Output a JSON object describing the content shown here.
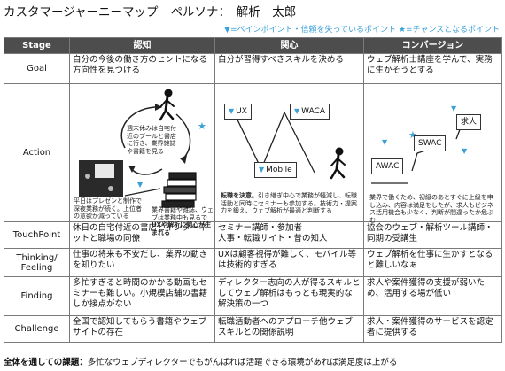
{
  "title": "カスタマージャーニーマップ",
  "persona": "ペルソナ：　解析　太郎",
  "legend": "▼=ペインポイント・信頼を失っているポイント ★=チャンスとなるポイント",
  "headers": [
    "Stage",
    "認知",
    "関心",
    "コンバージョン"
  ],
  "rows": {
    "goal": {
      "label": "Goal",
      "cells": [
        "自分の今後の働き方のヒントになる方向性を見つける",
        "自分が習得すべきスキルを決める",
        "ウェブ解析士講座を学んで、実務に生かそうとする"
      ]
    },
    "action": {
      "label": "Action"
    },
    "touchpoint": {
      "label": "TouchPoint",
      "cells": [
        "休日の自宅付近の書店とインターネットと職場の同僚",
        "セミナー講師・参加者\n人事・転職サイト・昔の知人",
        "協会のウェブ・解析ツール講師・同期の受講生"
      ]
    },
    "thinking": {
      "label": "Thinking/\nFeeling",
      "cells": [
        "仕事の将来も不安だし、業界の動きを知りたい",
        "UXは顧客視得が難しく、モバイル等は技術的すぎる",
        "ウェブ解析を仕事に生かすとなると難しいなぁ"
      ]
    },
    "finding": {
      "label": "Finding",
      "cells": [
        "多忙すぎると時間のかかる動画もセミナーも難しい。小規模店舗の書籍しか接点がない",
        "ディレクター志向の人が得るスキルとしてウェブ解析はもっとも現実的な解決策の一つ",
        "求人や案件獲得の支援が弱いため、活用する場が低い"
      ]
    },
    "challenge": {
      "label": "Challenge",
      "cells": [
        "全国で認知してもらう書籍やウェブサイトの存在",
        "転職活動者へのアプローチ他ウェブスキルとの関係説明",
        "求人・案件獲得のサービスを認定者に提供する"
      ]
    }
  },
  "action": {
    "col1": {
      "note_top": "週末休みは自宅付近のブールと書店に行き、業界雑誌や書籍を見る",
      "note_left": "平日はプレゼンと制作で深夜業務が続く。上位者の意欲が減っている",
      "note_right_plain": "業界書籍や雑誌、ウェブは業務中も見るで",
      "note_right_bold": "UXや解析に関心が生まれる"
    },
    "col2": {
      "box_ux": "UX",
      "box_waca": "WACA",
      "box_mobile": "Mobile",
      "note_bold": "転職を決意。",
      "note_plain": "引き継ぎ中心で業務が軽減し、転職活動と同時にセミナーも参加する。技術力・提案力を鍛え、ウェブ解析が最適と判断する"
    },
    "col3": {
      "box_awac": "AWAC",
      "box_swac": "SWAC",
      "box_kyujin": "求人",
      "note": "業界で働くため、初級のあとすぐに上級を申し込み、内容は満足をしたが、求人もビジネス活用機会も少なく、判断が間違ったか危ぶむ"
    }
  },
  "footer": {
    "label": "全体を通しての課題：",
    "text": "多忙なウェブディレクターでもがんばれば活躍できる環境があれば満足度は上がる"
  },
  "colors": {
    "header_bg": "#4d4d4d",
    "accent": "#3aa0d8"
  }
}
